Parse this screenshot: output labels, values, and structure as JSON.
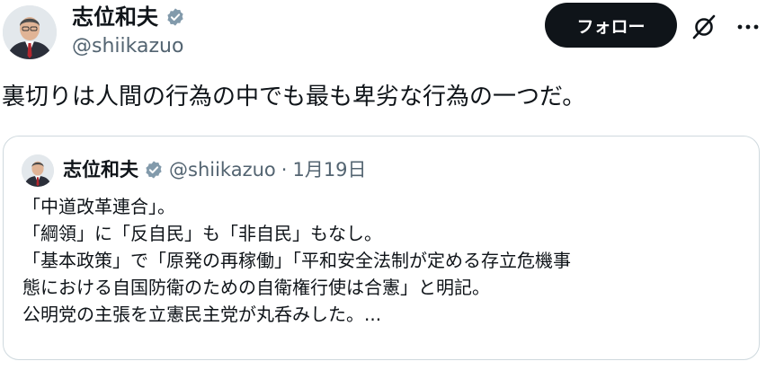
{
  "author": {
    "display_name": "志位和夫",
    "handle": "@shiikazuo",
    "verified_icon": "verified-badge-icon",
    "badge_color": "#829aab"
  },
  "actions": {
    "follow_label": "フォロー",
    "grok_icon": "grok-icon",
    "more_icon": "more-icon"
  },
  "post": {
    "text": "裏切りは人間の行為の中でも最も卑劣な行為の一つだ。"
  },
  "quoted": {
    "display_name": "志位和夫",
    "handle": "@shiikazuo",
    "separator": "·",
    "date": "1月19日",
    "lines": [
      "「中道改革連合」。",
      "「綱領」に「反自民」も「非自民」もなし。",
      "「基本政策」で「原発の再稼働」「平和安全法制が定める存立危機事",
      "態における自国防衛のための自衛権行使は合憲」と明記。",
      "公明党の主張を立憲民主党が丸呑みした。..."
    ]
  },
  "colors": {
    "text": "#0f1419",
    "secondary": "#536471",
    "border": "#cfd9de",
    "follow_bg": "#0f1419"
  }
}
